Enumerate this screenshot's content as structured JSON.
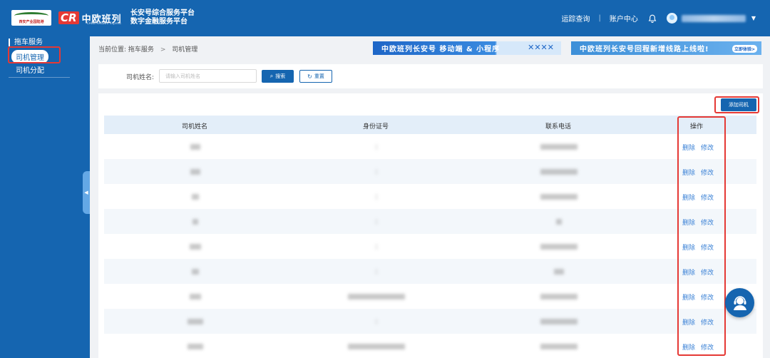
{
  "header": {
    "logo_left": "西安产业园陆港",
    "logo_cr": "CR",
    "logo_cn": "中欧班列",
    "logo_sub": "CHINA RAILWAY Express",
    "platform_line1": "长安号综合服务平台",
    "platform_line2": "数字金融服务平台",
    "nav_tracking": "运踪查询",
    "nav_account": "账户中心",
    "separator": "|",
    "username": ""
  },
  "sidebar": {
    "group": "拖车服务",
    "items": [
      {
        "label": "司机管理",
        "active": true
      },
      {
        "label": "司机分配",
        "active": false
      }
    ]
  },
  "breadcrumb": {
    "prefix": "当前位置:",
    "level1": "拖车服务",
    "sep": ">",
    "level2": "司机管理"
  },
  "banners": {
    "b1": "中欧班列长安号 移动端 & 小程序",
    "b2": "中欧班列长安号回程新增线路上线啦!",
    "b2_cta": "立即体验>"
  },
  "filter": {
    "label": "司机姓名:",
    "placeholder": "请输入司机姓名",
    "value": "",
    "search": "搜索",
    "reset": "重置"
  },
  "table": {
    "add_button": "添加司机",
    "columns": [
      "司机姓名",
      "身份证号",
      "联系电话",
      "操作"
    ],
    "actions": {
      "delete": "删除",
      "edit": "修改"
    },
    "rows": [
      {
        "name": "",
        "id": "",
        "phone": ""
      },
      {
        "name": "",
        "id": "",
        "phone": ""
      },
      {
        "name": "",
        "id": "",
        "phone": ""
      },
      {
        "name": "",
        "id": "",
        "phone": ""
      },
      {
        "name": "",
        "id": "",
        "phone": ""
      },
      {
        "name": "",
        "id": "",
        "phone": ""
      },
      {
        "name": "",
        "id": "",
        "phone": ""
      },
      {
        "name": "",
        "id": "",
        "phone": ""
      },
      {
        "name": "",
        "id": "",
        "phone": ""
      }
    ]
  },
  "colors": {
    "primary": "#1565b0",
    "link": "#3b82d6",
    "highlight": "#e53935",
    "header_row": "#e3eef9"
  },
  "icons": [
    "bell-icon",
    "avatar-icon",
    "caret-down-icon",
    "search-icon",
    "refresh-icon",
    "collapse-arrow-icon",
    "customer-service-icon"
  ]
}
